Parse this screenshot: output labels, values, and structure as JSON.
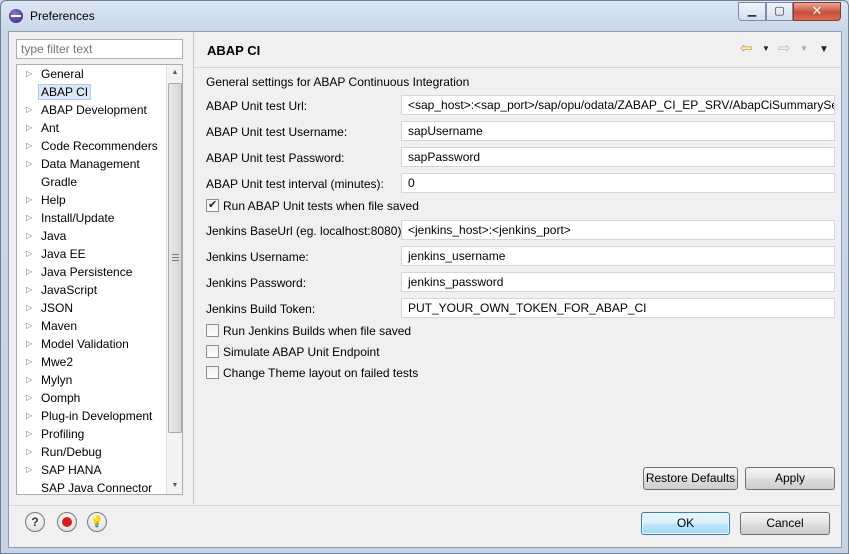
{
  "window": {
    "title": "Preferences"
  },
  "filter": {
    "placeholder": "type filter text"
  },
  "tree": {
    "items": [
      {
        "label": "General",
        "expandable": true
      },
      {
        "label": "ABAP CI",
        "expandable": false,
        "selected": true
      },
      {
        "label": "ABAP Development",
        "expandable": true
      },
      {
        "label": "Ant",
        "expandable": true
      },
      {
        "label": "Code Recommenders",
        "expandable": true
      },
      {
        "label": "Data Management",
        "expandable": true
      },
      {
        "label": "Gradle",
        "expandable": false
      },
      {
        "label": "Help",
        "expandable": true
      },
      {
        "label": "Install/Update",
        "expandable": true
      },
      {
        "label": "Java",
        "expandable": true
      },
      {
        "label": "Java EE",
        "expandable": true
      },
      {
        "label": "Java Persistence",
        "expandable": true
      },
      {
        "label": "JavaScript",
        "expandable": true
      },
      {
        "label": "JSON",
        "expandable": true
      },
      {
        "label": "Maven",
        "expandable": true
      },
      {
        "label": "Model Validation",
        "expandable": true
      },
      {
        "label": "Mwe2",
        "expandable": true
      },
      {
        "label": "Mylyn",
        "expandable": true
      },
      {
        "label": "Oomph",
        "expandable": true
      },
      {
        "label": "Plug-in Development",
        "expandable": true
      },
      {
        "label": "Profiling",
        "expandable": true
      },
      {
        "label": "Run/Debug",
        "expandable": true
      },
      {
        "label": "SAP HANA",
        "expandable": true
      },
      {
        "label": "SAP Java Connector",
        "expandable": false
      }
    ]
  },
  "page": {
    "title": "ABAP CI",
    "description": "General settings for ABAP Continuous Integration",
    "fields": {
      "unit_url": {
        "label": "ABAP Unit test Url:",
        "value": "<sap_host>:<sap_port>/sap/opu/odata/ZABAP_CI_EP_SRV/AbapCiSummarySet"
      },
      "unit_user": {
        "label": "ABAP Unit test Username:",
        "value": "sapUsername"
      },
      "unit_pass": {
        "label": "ABAP Unit test Password:",
        "value": "sapPassword"
      },
      "unit_interval": {
        "label": "ABAP Unit test interval (minutes):",
        "value": "0"
      },
      "jenkins_url": {
        "label": "Jenkins BaseUrl (eg. localhost:8080):",
        "value": "<jenkins_host>:<jenkins_port>"
      },
      "jenkins_user": {
        "label": "Jenkins Username:",
        "value": "jenkins_username"
      },
      "jenkins_pass": {
        "label": "Jenkins Password:",
        "value": "jenkins_password"
      },
      "jenkins_token": {
        "label": "Jenkins Build Token:",
        "value": "PUT_YOUR_OWN_TOKEN_FOR_ABAP_CI"
      }
    },
    "checks": {
      "run_unit": {
        "label": "Run ABAP Unit tests when file saved",
        "checked": true
      },
      "run_jenkins": {
        "label": "Run Jenkins Builds when file saved",
        "checked": false
      },
      "simulate": {
        "label": "Simulate ABAP Unit Endpoint",
        "checked": false
      },
      "theme": {
        "label": "Change Theme layout on failed tests",
        "checked": false
      }
    }
  },
  "buttons": {
    "restore_defaults": "Restore Defaults",
    "apply": "Apply",
    "ok": "OK",
    "cancel": "Cancel"
  },
  "footer_icons": {
    "help": "?",
    "record": "record-icon",
    "tip": "lightbulb-icon"
  },
  "colors": {
    "selection": "#dbe8f7",
    "default_button": "#bee6fd",
    "back_arrow": "#d69a1e"
  }
}
